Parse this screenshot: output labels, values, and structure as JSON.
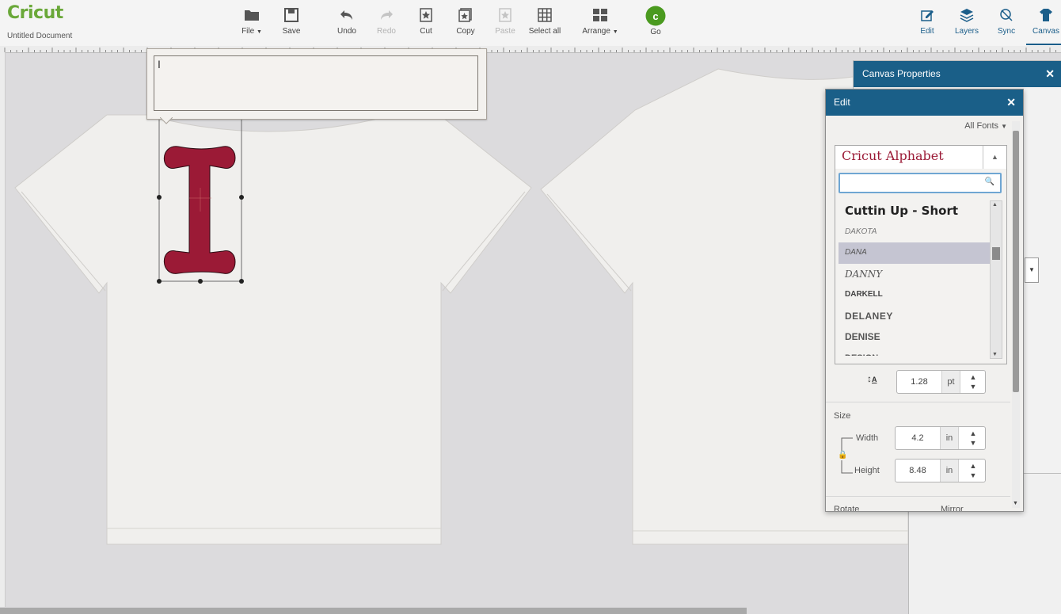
{
  "app": {
    "logo": "Cricut",
    "doc_title": "Untitled Document"
  },
  "toolbar": {
    "file": "File",
    "save": "Save",
    "undo": "Undo",
    "redo": "Redo",
    "cut": "Cut",
    "copy": "Copy",
    "paste": "Paste",
    "select_all": "Select all",
    "arrange": "Arrange",
    "go": "Go",
    "go_badge": "c"
  },
  "right_tabs": {
    "edit": "Edit",
    "layers": "Layers",
    "sync": "Sync",
    "canvas": "Canvas"
  },
  "canvas_props": {
    "title": "Canvas Properties"
  },
  "text_box": {
    "value": "I"
  },
  "edit_panel": {
    "title": "Edit",
    "all_fonts": "All Fonts",
    "selected_font": "Cricut Alphabet",
    "font_search_placeholder": "",
    "fonts": [
      "Cuttin Up - Short",
      "DAKOTA",
      "DANA",
      "DANNY",
      "DARKELL",
      "DELANEY",
      "DENISE",
      "DESIGN"
    ],
    "selected_index": 2,
    "letter_spacing": {
      "value": "1.28",
      "unit": "pt"
    },
    "size_label": "Size",
    "width_label": "Width",
    "width": {
      "value": "4.2",
      "unit": "in"
    },
    "height_label": "Height",
    "height": {
      "value": "8.48",
      "unit": "in"
    },
    "rotate_label": "Rotate",
    "mirror_label": "Mirror"
  },
  "colors": {
    "brand_green": "#6aa839",
    "header_blue": "#1a5f88",
    "letter_fill": "#9b1a36"
  }
}
